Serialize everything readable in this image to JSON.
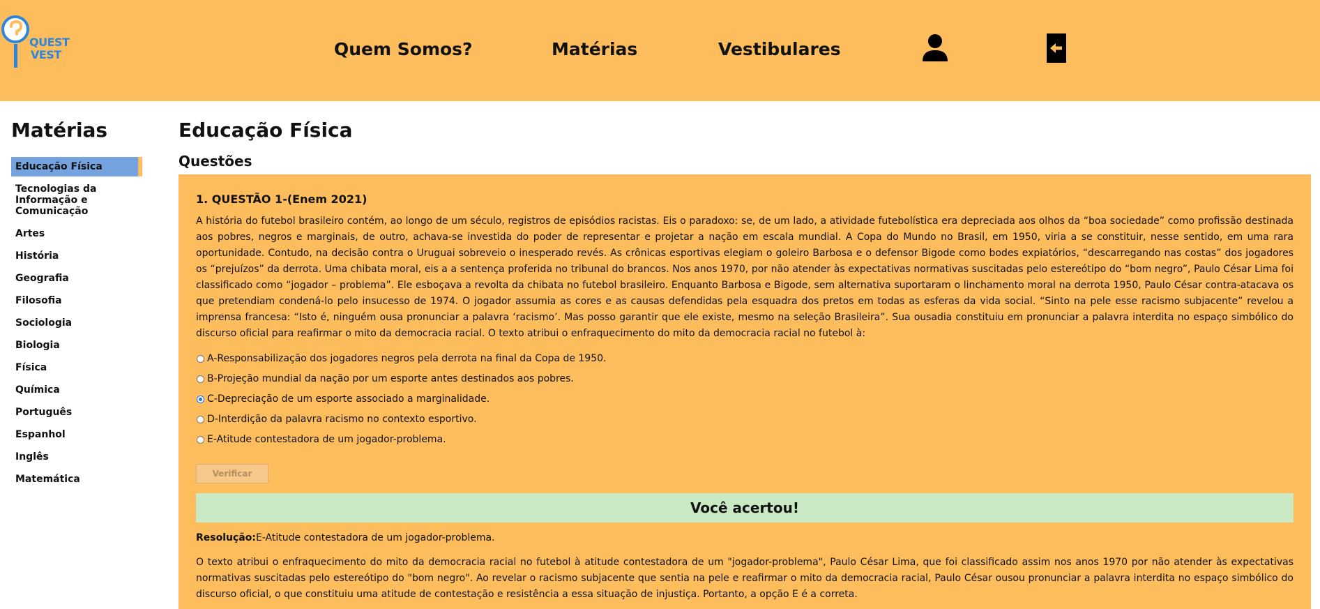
{
  "brand": {
    "line1": "QUEST",
    "line2": "VEST"
  },
  "nav": {
    "quem_somos": "Quem Somos?",
    "materias": "Matérias",
    "vestibulares": "Vestibulares"
  },
  "icons": {
    "profile": "user-icon",
    "logout": "exit-icon"
  },
  "colors": {
    "header": "#fdbd5d",
    "active": "#75a3e0",
    "success": "#c8e9c4"
  },
  "sidebar": {
    "title": "Matérias",
    "items": [
      {
        "label": "Educação Física",
        "active": true
      },
      {
        "label": "Tecnologias da Informação e Comunicação"
      },
      {
        "label": "Artes"
      },
      {
        "label": "História"
      },
      {
        "label": "Geografia"
      },
      {
        "label": "Filosofia"
      },
      {
        "label": "Sociologia"
      },
      {
        "label": "Biologia"
      },
      {
        "label": "Física"
      },
      {
        "label": "Química"
      },
      {
        "label": "Português"
      },
      {
        "label": "Espanhol"
      },
      {
        "label": "Inglês"
      },
      {
        "label": "Matemática"
      }
    ]
  },
  "main": {
    "title": "Educação Física",
    "section": "Questões"
  },
  "question": {
    "title": "1. QUESTÃO 1-(Enem 2021)",
    "text": "A história do futebol brasileiro contém, ao longo de um século, registros de episódios racistas. Eis o paradoxo: se, de um lado, a atividade futebolística era depreciada aos olhos da “boa sociedade” como profissão destinada aos pobres, negros e marginais, de outro, achava-se investida do poder de representar e projetar a nação em escala mundial. A Copa do Mundo no Brasil, em 1950, viria a se constituir, nesse sentido, em uma rara oportunidade. Contudo, na decisão contra o Uruguai sobreveio o inesperado revés. As crônicas esportivas elegiam o goleiro Barbosa e o defensor Bigode como bodes expiatórios, “descarregando nas costas” dos jogadores os “prejuízos” da derrota. Uma chibata moral, eis a a sentença proferida no tribunal do brancos. Nos anos 1970, por não atender às expectativas normativas suscitadas pelo estereótipo do “bom negro”, Paulo César Lima foi classificado como “jogador – problema”. Ele esboçava a revolta da chibata no futebol brasileiro. Enquanto Barbosa e Bigode, sem alternativa suportaram o linchamento moral na derrota 1950, Paulo César contra-atacava os que pretendiam condená-lo pelo insucesso de 1974. O jogador assumia as cores e as causas defendidas pela esquadra dos pretos em todas as esferas da vida social. “Sinto na pele esse racismo subjacente” revelou a imprensa francesa: “Isto é, ninguém ousa pronunciar a palavra ‘racismo’. Mas posso garantir que ele existe, mesmo na seleção Brasileira”. Sua ousadia constituiu em pronunciar a palavra interdita no espaço simbólico do discurso oficial para reafirmar o mito da democracia racial. O texto atribui o enfraquecimento do mito da democracia racial no futebol à:",
    "options": [
      {
        "label": "A-Responsabilização dos jogadores negros pela derrota na final da Copa de 1950.",
        "checked": false
      },
      {
        "label": "B-Projeção mundial da nação por um esporte antes destinados aos pobres.",
        "checked": false
      },
      {
        "label": "C-Depreciação de um esporte associado a marginalidade.",
        "checked": true
      },
      {
        "label": "D-Interdição da palavra racismo no contexto esportivo.",
        "checked": false
      },
      {
        "label": "E-Atitude contestadora de um jogador-problema.",
        "checked": false
      }
    ],
    "verify_label": "Verificar",
    "result_message": "Você acertou!",
    "resolution_label": "Resolução:",
    "resolution_answer": "E-Atitude contestadora de um jogador-problema.",
    "explanation": "O texto atribui o enfraquecimento do mito da democracia racial no futebol à atitude contestadora de um \"jogador-problema\", Paulo César Lima, que foi classificado assim nos anos 1970 por não atender às expectativas normativas suscitadas pelo estereótipo do \"bom negro\". Ao revelar o racismo subjacente que sentia na pele e reafirmar o mito da democracia racial, Paulo César ousou pronunciar a palavra interdita no espaço simbólico do discurso oficial, o que constituiu uma atitude de contestação e resistência a essa situação de injustiça. Portanto, a opção E é a correta."
  }
}
